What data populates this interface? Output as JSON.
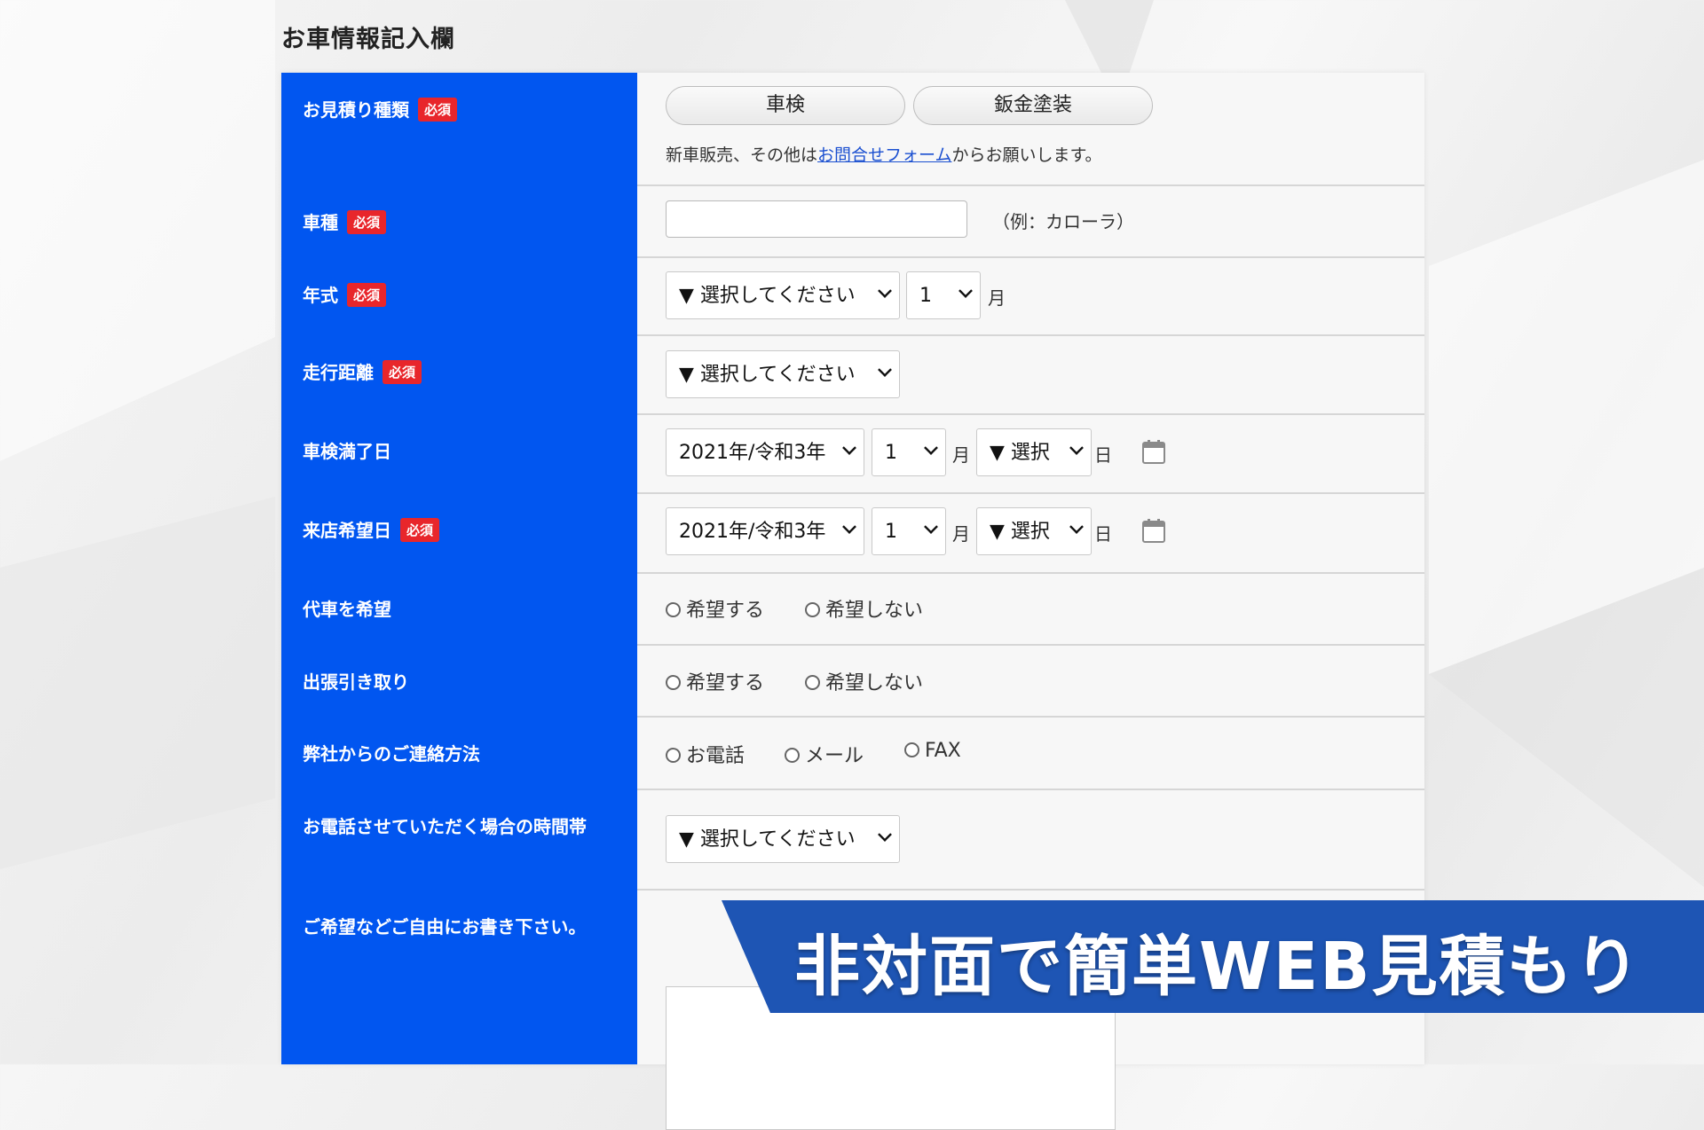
{
  "section_title": "お車情報記入欄",
  "required_badge": "必須",
  "rows": {
    "estimate_type": {
      "label": "お見積り種類",
      "options": [
        "車検",
        "鈑金塗装"
      ],
      "note_before": "新車販売、その他は",
      "note_link": "お問合せフォーム",
      "note_after": "からお願いします。"
    },
    "car_model": {
      "label": "車種",
      "placeholder": "",
      "example": "（例：カローラ）"
    },
    "model_year": {
      "label": "年式",
      "select_value": "▼ 選択してください",
      "month_value": "1",
      "month_unit": "月"
    },
    "mileage": {
      "label": "走行距離",
      "select_value": "▼ 選択してください"
    },
    "inspection_expiry": {
      "label": "車検満了日",
      "year_value": "2021年/令和3年",
      "month_value": "1",
      "month_unit": "月",
      "day_value": "▼ 選択",
      "day_unit": "日"
    },
    "visit_date": {
      "label": "来店希望日",
      "year_value": "2021年/令和3年",
      "month_value": "1",
      "month_unit": "月",
      "day_value": "▼ 選択",
      "day_unit": "日"
    },
    "loaner_car": {
      "label": "代車を希望",
      "options": [
        "希望する",
        "希望しない"
      ]
    },
    "pickup": {
      "label": "出張引き取り",
      "options": [
        "希望する",
        "希望しない"
      ]
    },
    "contact_method": {
      "label": "弊社からのご連絡方法",
      "options": [
        "お電話",
        "メール",
        "FAX"
      ]
    },
    "call_time": {
      "label": "お電話させていただく場合の時間帯",
      "select_value": "▼ 選択してください"
    },
    "comments": {
      "label": "ご希望などご自由にお書き下さい。"
    }
  },
  "banner_text": "非対面で簡単WEB見積もり",
  "colors": {
    "label_bg": "#0156f0",
    "required_bg": "#e8262b",
    "banner_bg": "#1e55b4"
  }
}
